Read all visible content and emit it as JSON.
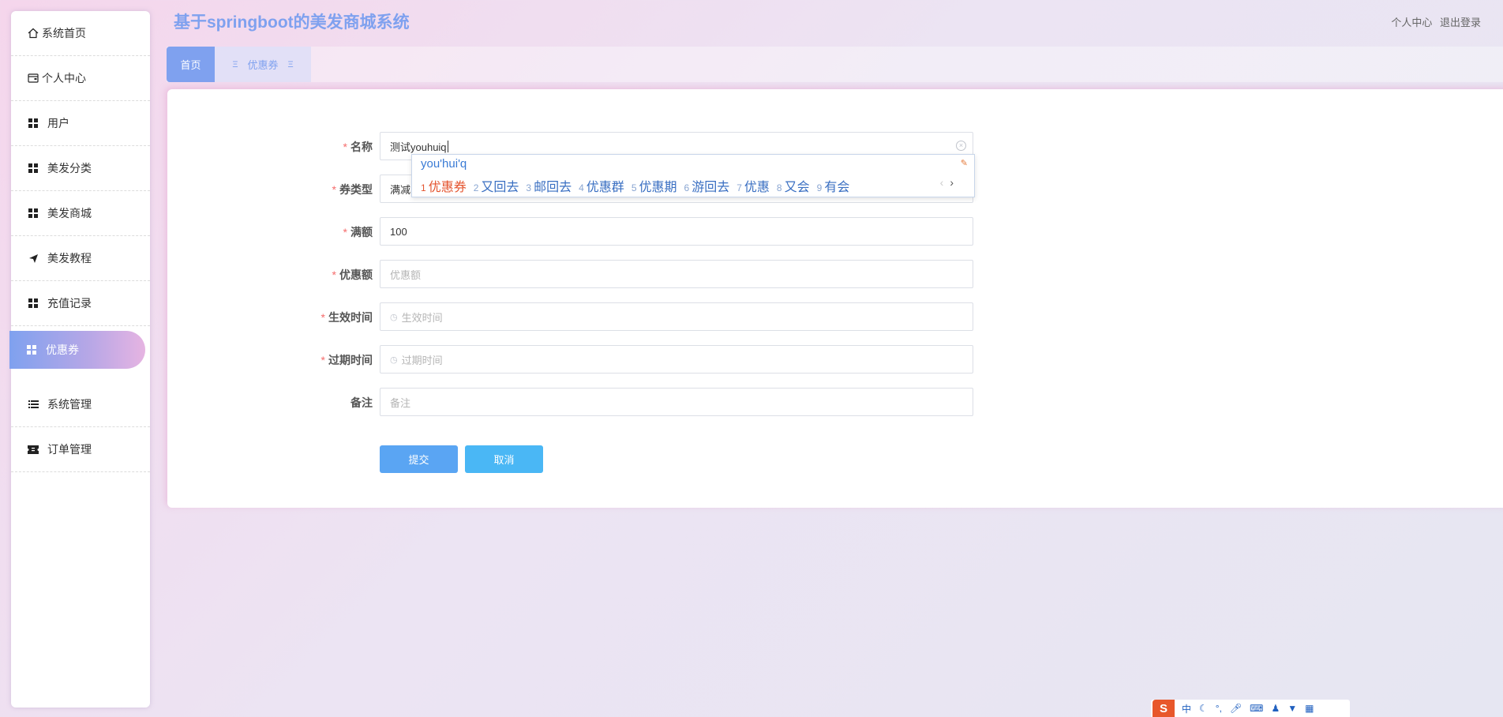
{
  "app": {
    "title": "基于springboot的美发商城系统"
  },
  "header": {
    "personal_center": "个人中心",
    "logout": "退出登录"
  },
  "sidebar": {
    "items": [
      {
        "label": "系统首页",
        "icon": "home-icon"
      },
      {
        "label": "个人中心",
        "icon": "wallet-icon"
      },
      {
        "label": "用户",
        "icon": "grid-icon"
      },
      {
        "label": "美发分类",
        "icon": "grid-icon"
      },
      {
        "label": "美发商城",
        "icon": "grid-icon"
      },
      {
        "label": "美发教程",
        "icon": "paper-plane-icon"
      },
      {
        "label": "充值记录",
        "icon": "grid-icon"
      },
      {
        "label": "优惠券",
        "icon": "grid-icon",
        "active": true
      },
      {
        "label": "系统管理",
        "icon": "list-icon"
      },
      {
        "label": "订单管理",
        "icon": "ticket-icon"
      }
    ]
  },
  "tabs": {
    "home": "首页",
    "coupon": "优惠券"
  },
  "form": {
    "name": {
      "label": "名称",
      "value": "测试youhuiq"
    },
    "type": {
      "label": "券类型",
      "value": "满减"
    },
    "threshold": {
      "label": "满额",
      "value": "100"
    },
    "discount": {
      "label": "优惠额",
      "placeholder": "优惠额"
    },
    "start_time": {
      "label": "生效时间",
      "placeholder": "生效时间"
    },
    "end_time": {
      "label": "过期时间",
      "placeholder": "过期时间"
    },
    "remark": {
      "label": "备注",
      "placeholder": "备注"
    },
    "submit": "提交",
    "cancel": "取消"
  },
  "ime": {
    "composition": "you'hui'q",
    "candidates": [
      {
        "n": "1",
        "text": "优惠券"
      },
      {
        "n": "2",
        "text": "又回去"
      },
      {
        "n": "3",
        "text": "邮回去"
      },
      {
        "n": "4",
        "text": "优惠群"
      },
      {
        "n": "5",
        "text": "优惠期"
      },
      {
        "n": "6",
        "text": "游回去"
      },
      {
        "n": "7",
        "text": "优惠"
      },
      {
        "n": "8",
        "text": "又会"
      },
      {
        "n": "9",
        "text": "有会"
      }
    ],
    "bar_lang": "中"
  },
  "colors": {
    "accent": "#7fa1ef",
    "required": "#f56c6c",
    "submit": "#5aa5f3",
    "cancel": "#4ab7f5"
  }
}
